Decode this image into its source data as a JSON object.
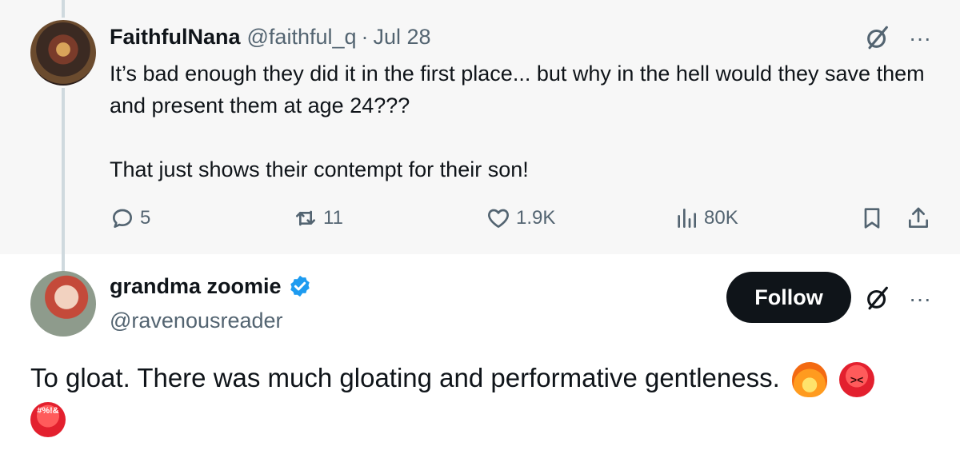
{
  "parent_tweet": {
    "author_name": "FaithfulNana",
    "handle": "@faithful_q",
    "separator": "·",
    "date": "Jul 28",
    "more_label": "···",
    "text_line1": "It’s bad enough they did it in the first place... but why in the hell would they save them and present them at age 24???",
    "text_line2": "That just shows their contempt for their son!",
    "stats": {
      "replies": "5",
      "reposts": "11",
      "likes": "1.9K",
      "views": "80K"
    },
    "icons": {
      "reply": "reply-icon",
      "repost": "repost-icon",
      "like": "heart-icon",
      "views": "views-chart-icon",
      "bookmark": "bookmark-icon",
      "share": "share-icon",
      "grok": "grok-icon"
    }
  },
  "reply_tweet": {
    "author_name": "grandma zoomie",
    "handle": "@ravenousreader",
    "follow_label": "Follow",
    "more_label": "···",
    "text": "To gloat. There was much gloating and performative gentleness.",
    "symbols_emoji_text": "#%!&",
    "verified_color": "#1d9bf0"
  },
  "colors": {
    "highlight_bg": "#f7f7f7",
    "muted_text": "#536471",
    "primary_text": "#0f1419",
    "follow_bg": "#0f1419"
  }
}
